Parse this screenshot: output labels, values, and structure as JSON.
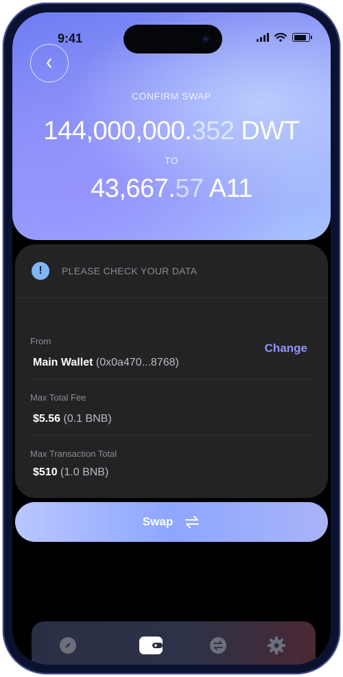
{
  "status_bar": {
    "time": "9:41"
  },
  "header": {
    "title": "CONFIRM SWAP",
    "from_amount_main": "144,000,000.",
    "from_amount_decimal": "352",
    "from_token": "DWT",
    "to_label": "TO",
    "to_amount_main": "43,667.",
    "to_amount_decimal": "57",
    "to_token": "A11"
  },
  "notice": {
    "text": "PLEASE CHECK YOUR DATA",
    "icon": "exclamation-icon"
  },
  "details": {
    "from_label": "From",
    "from_wallet": "Main Wallet",
    "from_address": "(0x0a470...8768)",
    "change_label": "Change",
    "fee_label": "Max Total Fee",
    "fee_value": "$5.56",
    "fee_sub": "(0.1 BNB)",
    "total_label": "Max Transaction Total",
    "total_value": "$510",
    "total_sub": "(1.0 BNB)"
  },
  "swap_button": {
    "label": "Swap"
  },
  "bottom_nav": {
    "items": [
      "compass-icon",
      "wallet-icon",
      "swap-icon",
      "gear-icon"
    ],
    "active": 1
  },
  "colors": {
    "accent": "#8e93ff",
    "card": "#232325",
    "notice_badge": "#7fb6f6"
  }
}
